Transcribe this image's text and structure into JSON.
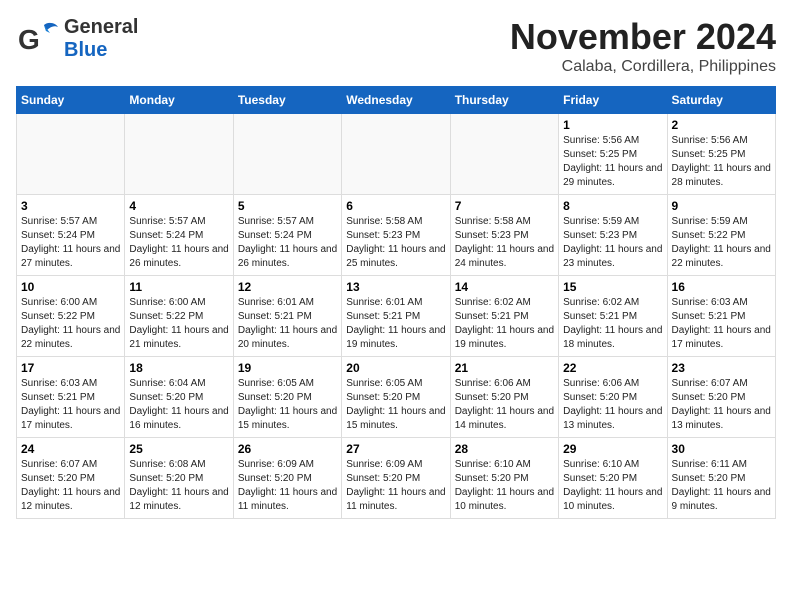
{
  "header": {
    "logo_general": "General",
    "logo_blue": "Blue",
    "title": "November 2024",
    "subtitle": "Calaba, Cordillera, Philippines"
  },
  "days_of_week": [
    "Sunday",
    "Monday",
    "Tuesday",
    "Wednesday",
    "Thursday",
    "Friday",
    "Saturday"
  ],
  "weeks": [
    [
      {
        "day": "",
        "info": ""
      },
      {
        "day": "",
        "info": ""
      },
      {
        "day": "",
        "info": ""
      },
      {
        "day": "",
        "info": ""
      },
      {
        "day": "",
        "info": ""
      },
      {
        "day": "1",
        "info": "Sunrise: 5:56 AM\nSunset: 5:25 PM\nDaylight: 11 hours and 29 minutes."
      },
      {
        "day": "2",
        "info": "Sunrise: 5:56 AM\nSunset: 5:25 PM\nDaylight: 11 hours and 28 minutes."
      }
    ],
    [
      {
        "day": "3",
        "info": "Sunrise: 5:57 AM\nSunset: 5:24 PM\nDaylight: 11 hours and 27 minutes."
      },
      {
        "day": "4",
        "info": "Sunrise: 5:57 AM\nSunset: 5:24 PM\nDaylight: 11 hours and 26 minutes."
      },
      {
        "day": "5",
        "info": "Sunrise: 5:57 AM\nSunset: 5:24 PM\nDaylight: 11 hours and 26 minutes."
      },
      {
        "day": "6",
        "info": "Sunrise: 5:58 AM\nSunset: 5:23 PM\nDaylight: 11 hours and 25 minutes."
      },
      {
        "day": "7",
        "info": "Sunrise: 5:58 AM\nSunset: 5:23 PM\nDaylight: 11 hours and 24 minutes."
      },
      {
        "day": "8",
        "info": "Sunrise: 5:59 AM\nSunset: 5:23 PM\nDaylight: 11 hours and 23 minutes."
      },
      {
        "day": "9",
        "info": "Sunrise: 5:59 AM\nSunset: 5:22 PM\nDaylight: 11 hours and 22 minutes."
      }
    ],
    [
      {
        "day": "10",
        "info": "Sunrise: 6:00 AM\nSunset: 5:22 PM\nDaylight: 11 hours and 22 minutes."
      },
      {
        "day": "11",
        "info": "Sunrise: 6:00 AM\nSunset: 5:22 PM\nDaylight: 11 hours and 21 minutes."
      },
      {
        "day": "12",
        "info": "Sunrise: 6:01 AM\nSunset: 5:21 PM\nDaylight: 11 hours and 20 minutes."
      },
      {
        "day": "13",
        "info": "Sunrise: 6:01 AM\nSunset: 5:21 PM\nDaylight: 11 hours and 19 minutes."
      },
      {
        "day": "14",
        "info": "Sunrise: 6:02 AM\nSunset: 5:21 PM\nDaylight: 11 hours and 19 minutes."
      },
      {
        "day": "15",
        "info": "Sunrise: 6:02 AM\nSunset: 5:21 PM\nDaylight: 11 hours and 18 minutes."
      },
      {
        "day": "16",
        "info": "Sunrise: 6:03 AM\nSunset: 5:21 PM\nDaylight: 11 hours and 17 minutes."
      }
    ],
    [
      {
        "day": "17",
        "info": "Sunrise: 6:03 AM\nSunset: 5:21 PM\nDaylight: 11 hours and 17 minutes."
      },
      {
        "day": "18",
        "info": "Sunrise: 6:04 AM\nSunset: 5:20 PM\nDaylight: 11 hours and 16 minutes."
      },
      {
        "day": "19",
        "info": "Sunrise: 6:05 AM\nSunset: 5:20 PM\nDaylight: 11 hours and 15 minutes."
      },
      {
        "day": "20",
        "info": "Sunrise: 6:05 AM\nSunset: 5:20 PM\nDaylight: 11 hours and 15 minutes."
      },
      {
        "day": "21",
        "info": "Sunrise: 6:06 AM\nSunset: 5:20 PM\nDaylight: 11 hours and 14 minutes."
      },
      {
        "day": "22",
        "info": "Sunrise: 6:06 AM\nSunset: 5:20 PM\nDaylight: 11 hours and 13 minutes."
      },
      {
        "day": "23",
        "info": "Sunrise: 6:07 AM\nSunset: 5:20 PM\nDaylight: 11 hours and 13 minutes."
      }
    ],
    [
      {
        "day": "24",
        "info": "Sunrise: 6:07 AM\nSunset: 5:20 PM\nDaylight: 11 hours and 12 minutes."
      },
      {
        "day": "25",
        "info": "Sunrise: 6:08 AM\nSunset: 5:20 PM\nDaylight: 11 hours and 12 minutes."
      },
      {
        "day": "26",
        "info": "Sunrise: 6:09 AM\nSunset: 5:20 PM\nDaylight: 11 hours and 11 minutes."
      },
      {
        "day": "27",
        "info": "Sunrise: 6:09 AM\nSunset: 5:20 PM\nDaylight: 11 hours and 11 minutes."
      },
      {
        "day": "28",
        "info": "Sunrise: 6:10 AM\nSunset: 5:20 PM\nDaylight: 11 hours and 10 minutes."
      },
      {
        "day": "29",
        "info": "Sunrise: 6:10 AM\nSunset: 5:20 PM\nDaylight: 11 hours and 10 minutes."
      },
      {
        "day": "30",
        "info": "Sunrise: 6:11 AM\nSunset: 5:20 PM\nDaylight: 11 hours and 9 minutes."
      }
    ]
  ]
}
